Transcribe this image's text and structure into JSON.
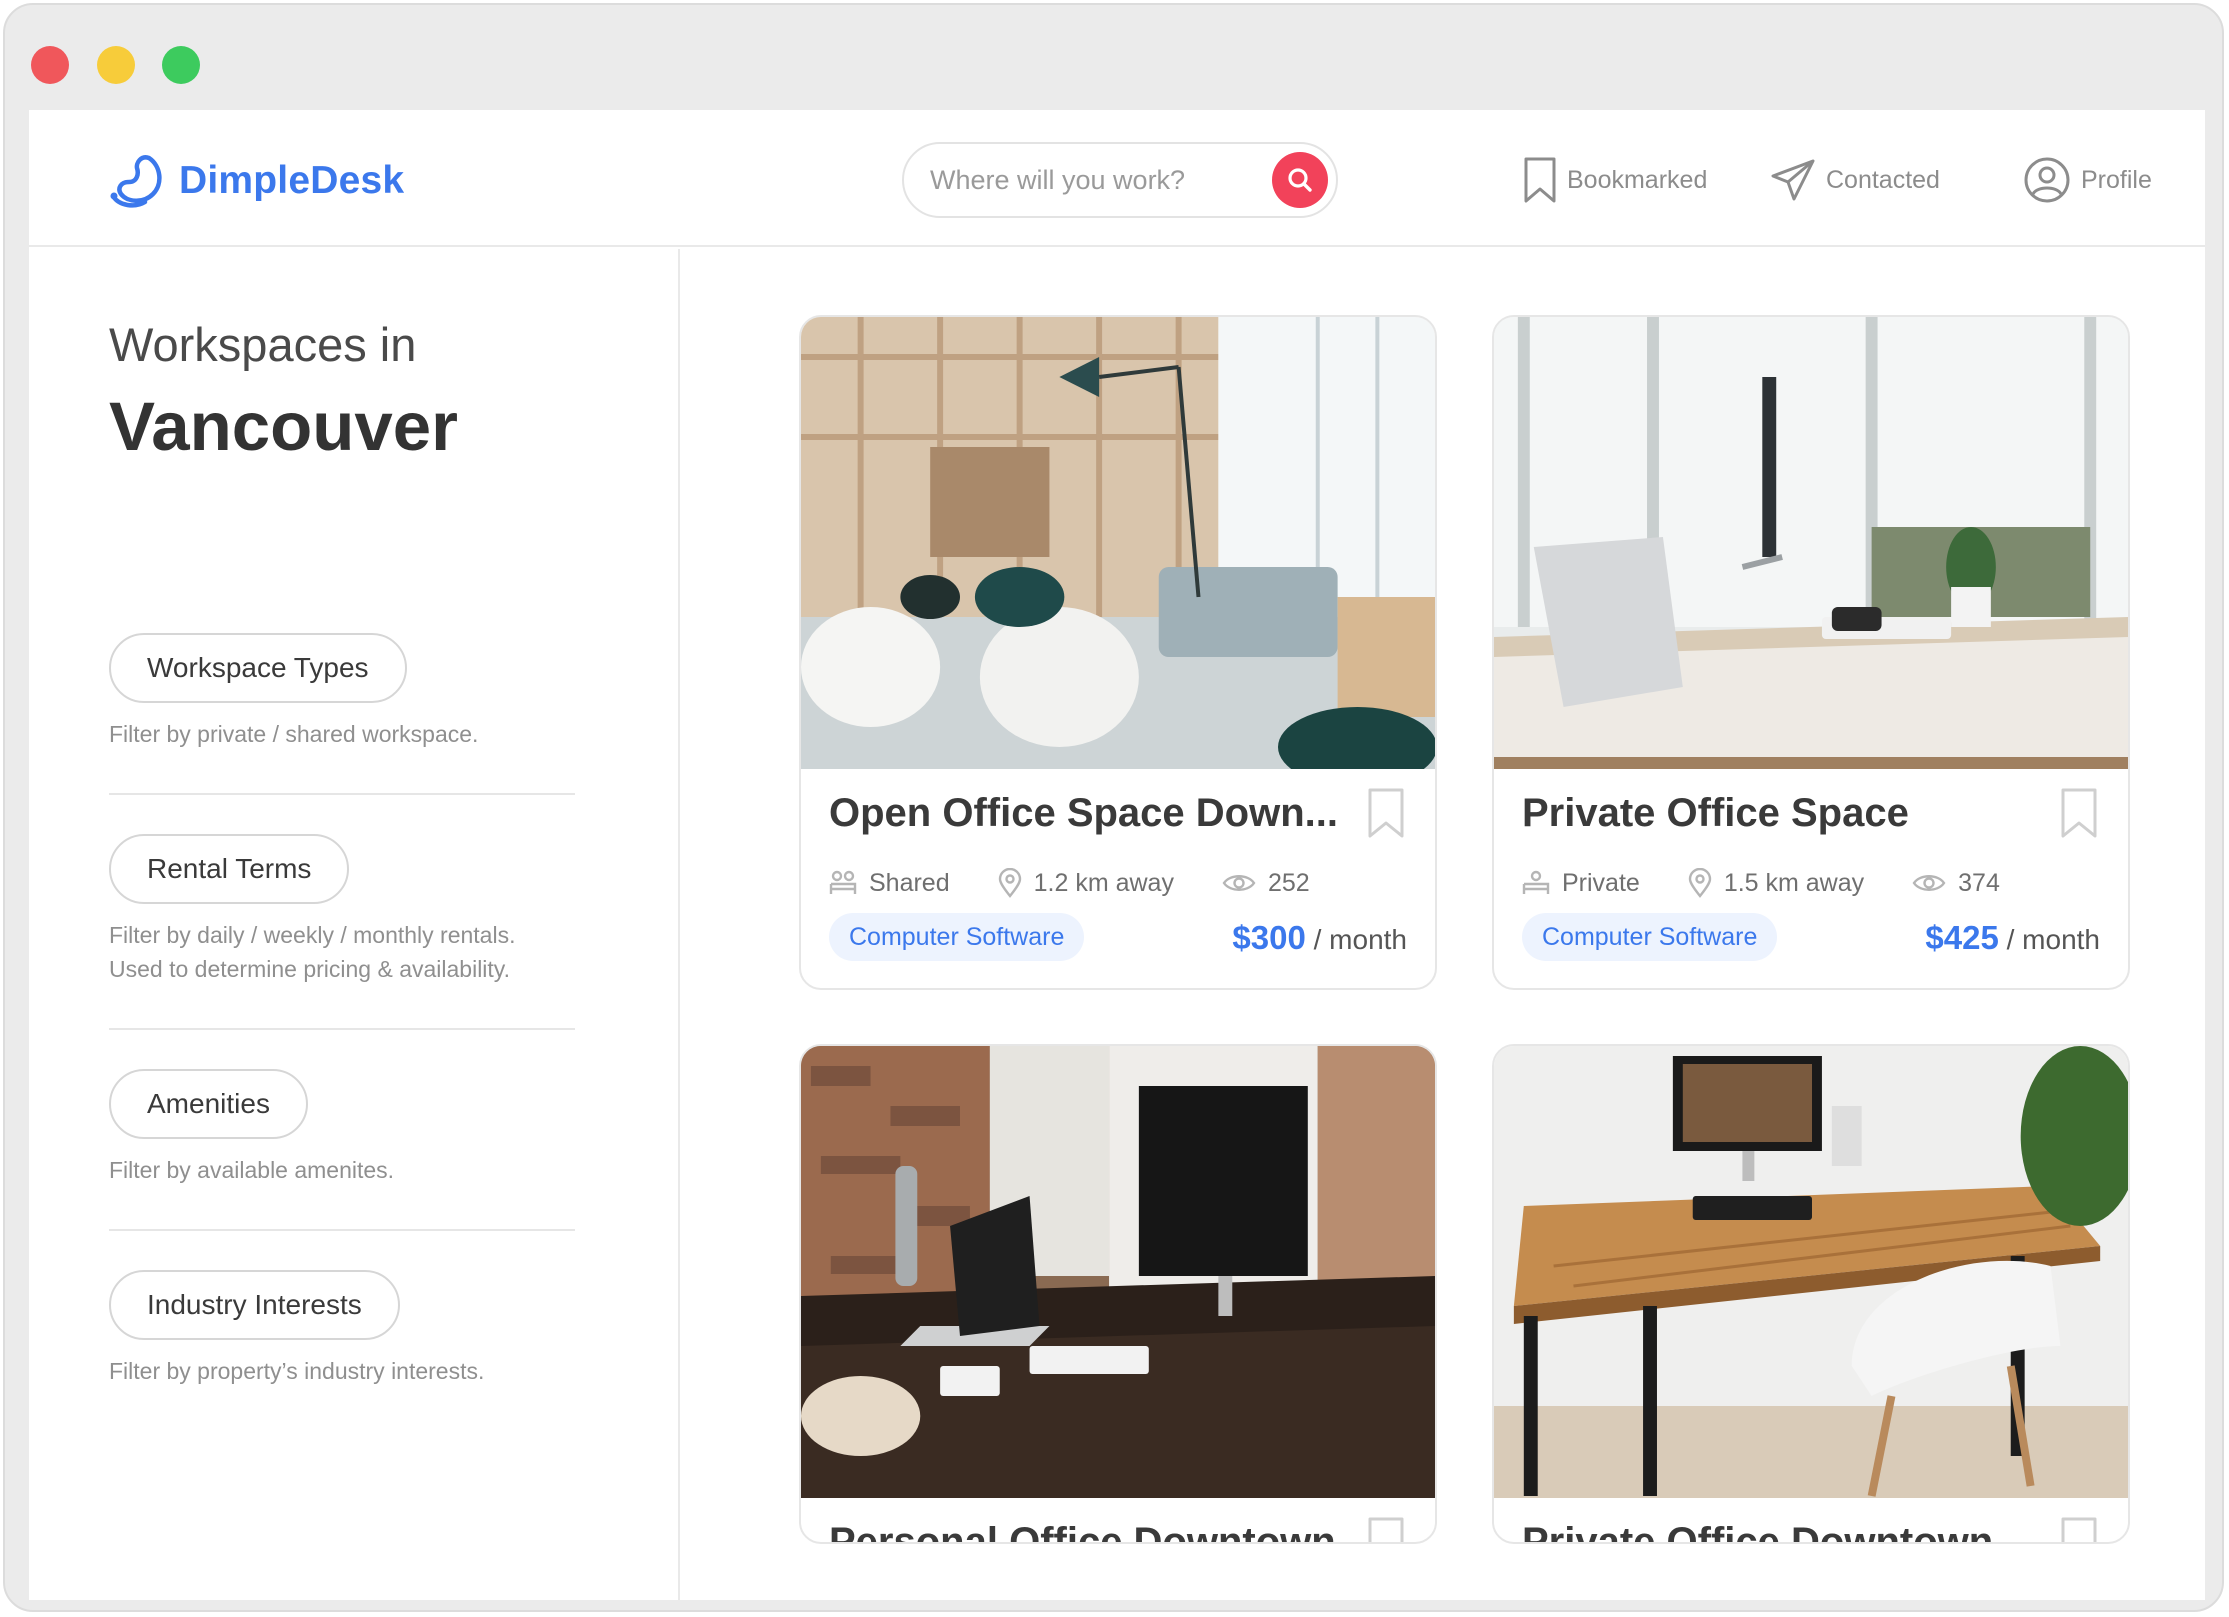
{
  "header": {
    "brand": "DimpleDesk",
    "search_placeholder": "Where will you work?",
    "nav": [
      {
        "label": "Bookmarked",
        "icon": "bookmark-icon"
      },
      {
        "label": "Contacted",
        "icon": "paper-plane-icon"
      },
      {
        "label": "Profile",
        "icon": "user-circle-icon"
      }
    ]
  },
  "sidebar": {
    "heading_line1": "Workspaces in",
    "heading_city": "Vancouver",
    "filters": [
      {
        "label": "Workspace Types",
        "description": "Filter by private / shared workspace."
      },
      {
        "label": "Rental Terms",
        "description": "Filter by daily / weekly / monthly rentals.\nUsed to determine pricing & availability."
      },
      {
        "label": "Amenities",
        "description": "Filter by available amenites."
      },
      {
        "label": "Industry Interests",
        "description": "Filter by property’s industry interests."
      }
    ]
  },
  "listings": [
    {
      "title": "Open Office Space Down...",
      "type": "Shared",
      "distance": "1.2 km away",
      "views": "252",
      "tag": "Computer Software",
      "price": "$300",
      "period": "/ month"
    },
    {
      "title": "Private Office Space",
      "type": "Private",
      "distance": "1.5 km away",
      "views": "374",
      "tag": "Computer Software",
      "price": "$425",
      "period": "/ month"
    },
    {
      "title": "Personal Office Downtown"
    },
    {
      "title": "Private Office Downtown..."
    }
  ],
  "colors": {
    "brand": "#3b78ec",
    "search_button": "#f2425a",
    "tag_bg": "#edf3fe"
  }
}
